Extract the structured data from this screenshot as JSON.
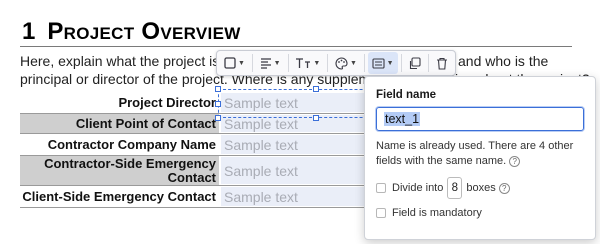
{
  "heading": {
    "number": "1",
    "title": "Project Overview"
  },
  "paragraph": {
    "line1_start": "Here, explain what the project is abo",
    "line1_end": "and who is the",
    "line2": "principal or director of the project. Where is any supplemental information about the project?"
  },
  "table": {
    "rows": [
      {
        "label": "Project Director",
        "placeholder": "Sample text",
        "shaded": false
      },
      {
        "label": "Client Point of Contact",
        "placeholder": "Sample text",
        "shaded": true
      },
      {
        "label": "Contractor Company Name",
        "placeholder": "Sample text",
        "shaded": false
      },
      {
        "label_line1": "Contractor-Side Emergency",
        "label_line2": "Contact",
        "placeholder": "Sample text",
        "shaded": true
      },
      {
        "label": "Client-Side Emergency Contact",
        "placeholder": "Sample text",
        "shaded": false
      }
    ]
  },
  "toolbar": {
    "buttons": [
      "border-style",
      "text-align",
      "font-size",
      "color-palette",
      "field-style",
      "duplicate",
      "delete"
    ],
    "active": "field-style"
  },
  "popup": {
    "title": "Field name",
    "field_value": "text_1",
    "warning": "Name is already used. There are 4 other fields with the same name.",
    "divide_label_before": "Divide into",
    "divide_value": "8",
    "divide_label_after": "boxes",
    "mandatory_label": "Field is mandatory",
    "divide_checked": false,
    "mandatory_checked": false
  },
  "colors": {
    "accent": "#3b6fd8",
    "field_fill": "#eaeef8",
    "row_shade": "#cfcfcf"
  }
}
